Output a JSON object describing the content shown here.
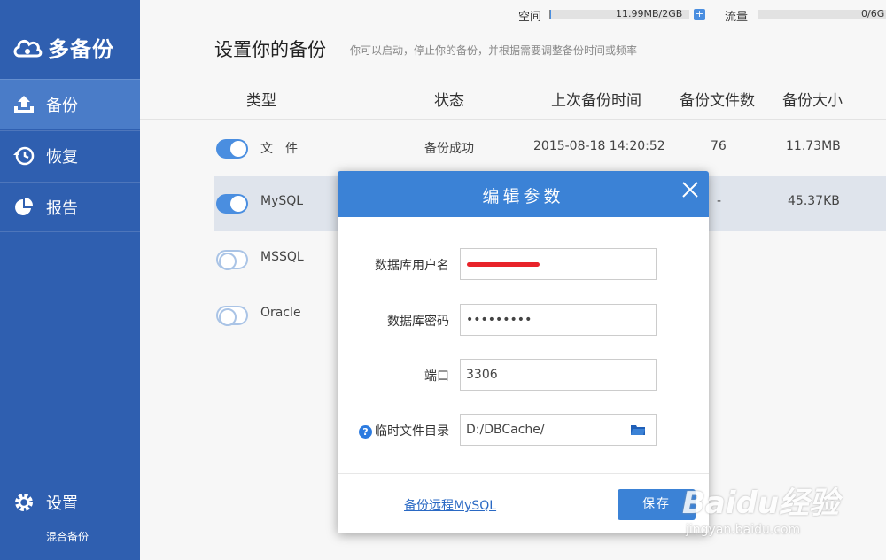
{
  "sidebar": {
    "logo_text": "多备份",
    "nav": [
      {
        "label": "备份",
        "icon": "upload-icon"
      },
      {
        "label": "恢复",
        "icon": "history-icon"
      },
      {
        "label": "报告",
        "icon": "pie-chart-icon"
      }
    ],
    "settings_label": "设置",
    "mode_label": "混合备份"
  },
  "topbar": {
    "space_label": "空间",
    "space_value": "11.99MB/2GB",
    "space_used_fraction": 0.006,
    "plus": "+",
    "traffic_label": "流量",
    "traffic_value": "0/6G",
    "traffic_used_fraction": 0
  },
  "main": {
    "title": "设置你的备份",
    "subtitle": "你可以启动，停止你的备份，并根据需要调整备份时间或频率",
    "headers": [
      "类型",
      "状态",
      "上次备份时间",
      "备份文件数",
      "备份大小"
    ],
    "rows": [
      {
        "name": "文　件",
        "enabled": true,
        "status": "备份成功",
        "last_time": "2015-08-18 14:20:52",
        "count": "76",
        "size": "11.73MB"
      },
      {
        "name": "MySQL",
        "enabled": true,
        "status": "",
        "last_time": "",
        "count": "-",
        "size": "45.37KB"
      },
      {
        "name": "MSSQL",
        "enabled": false,
        "status": "",
        "last_time": "",
        "count": "",
        "size": ""
      },
      {
        "name": "Oracle",
        "enabled": false,
        "status": "",
        "last_time": "",
        "count": "",
        "size": ""
      }
    ]
  },
  "dialog": {
    "title": "编辑参数",
    "username_label": "数据库用户名",
    "username_value": "",
    "password_label": "数据库密码",
    "password_value": "•••••••••",
    "port_label": "端口",
    "port_value": "3306",
    "tempdir_label": "临时文件目录",
    "tempdir_value": "D:/DBCache/",
    "help": "?",
    "remote_link": "备份远程MySQL",
    "save_label": "保存"
  },
  "watermark": {
    "main": "Baidu经验",
    "sub": "jingyan.baidu.com"
  },
  "colors": {
    "sidebar": "#2f5fb0",
    "accent": "#3b82d6",
    "active_nav": "#4a7cc8"
  }
}
